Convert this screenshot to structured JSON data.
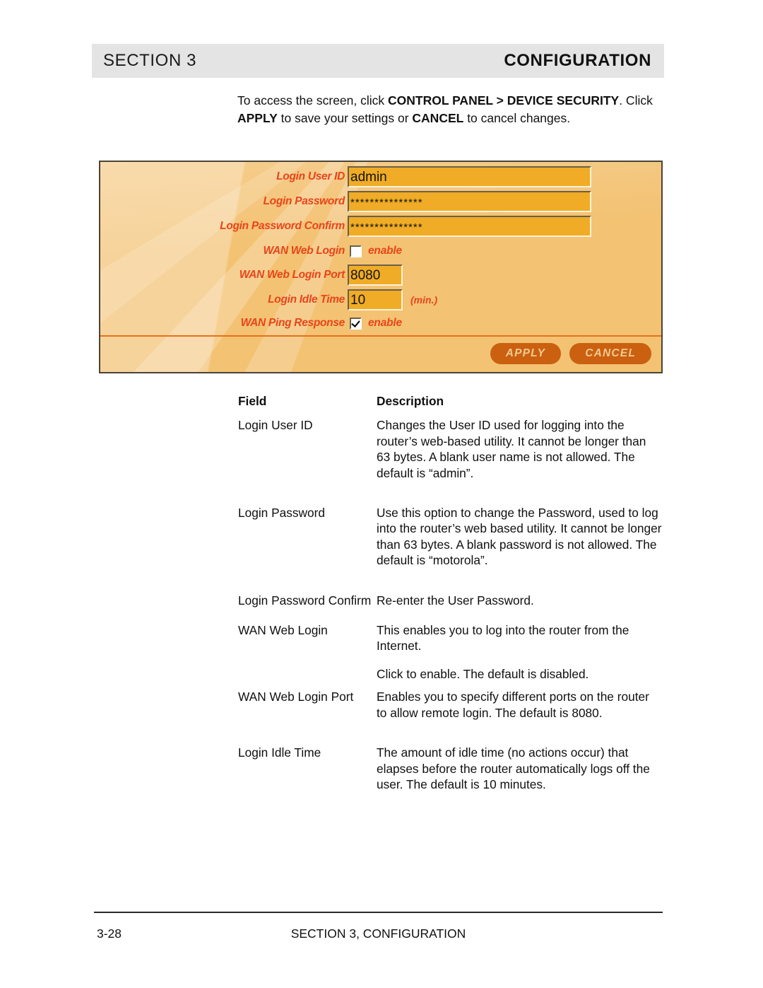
{
  "page": {
    "header": {
      "section_label": "SECTION 3",
      "title": "CONFIGURATION"
    },
    "intro": {
      "part1": "To access the screen, click ",
      "bold1": "CONTROL PANEL > DEVICE SECURITY",
      "part2": ". Click ",
      "bold2": "APPLY",
      "part3": " to save your settings or ",
      "bold3": "CANCEL",
      "part4": " to cancel changes."
    },
    "footer": {
      "page_number": "3-28",
      "center_text": "SECTION 3, CONFIGURATION"
    }
  },
  "router_panel": {
    "colors": {
      "background": "#f3c273",
      "field_fill": "#f0ac26",
      "label_text": "#e8451a",
      "divider": "#e8701a",
      "button_fill": "#ca6010",
      "button_text": "#f3c98f",
      "panel_border": "#4a4438"
    },
    "fields": [
      {
        "label": "Login User ID",
        "value": "admin",
        "type": "text"
      },
      {
        "label": "Login Password",
        "value": "***************",
        "type": "password"
      },
      {
        "label": "Login Password Confirm",
        "value": "***************",
        "type": "password"
      },
      {
        "label": "WAN Web Login",
        "value": "",
        "type": "checkbox",
        "checked": false,
        "checkbox_label": "enable"
      },
      {
        "label": "WAN Web Login Port",
        "value": "8080",
        "type": "text"
      },
      {
        "label": "Login Idle Time",
        "value": "10",
        "type": "text",
        "unit": "(min.)"
      },
      {
        "label": "WAN Ping Response",
        "value": "",
        "type": "checkbox",
        "checked": true,
        "checkbox_label": "enable"
      }
    ],
    "buttons": {
      "apply": "APPLY",
      "cancel": "CANCEL"
    }
  },
  "field_table": {
    "headers": {
      "field": "Field",
      "description": "Description"
    },
    "rows": [
      {
        "field": "Login User ID",
        "description": "Changes the User ID used for logging into the router’s web-based utility. It cannot be longer than 63 bytes. A blank user name is not allowed. The default is “admin”."
      },
      {
        "field": "Login Password",
        "description": "Use this option to change the Password, used to log into the router’s web based utility. It cannot be longer than 63 bytes. A blank password is not allowed. The default is “motorola”."
      },
      {
        "field": "Login Password Confirm",
        "description": "Re-enter the User Password."
      },
      {
        "field": "WAN Web Login",
        "description": "This enables you to log into the router from the Internet.",
        "description2": "Click to enable. The default is disabled."
      },
      {
        "field": "WAN Web Login Port",
        "description": "Enables you to specify different ports on the router to allow remote login. The default is 8080."
      },
      {
        "field": "Login Idle Time",
        "description": "The amount of idle time (no actions occur) that elapses before the router automatically logs off the user. The default is 10 minutes."
      }
    ]
  }
}
